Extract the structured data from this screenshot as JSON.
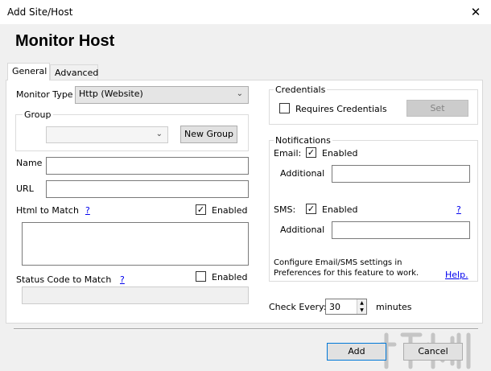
{
  "window": {
    "title": "Add Site/Host",
    "close_glyph": "✕"
  },
  "heading": "Monitor Host",
  "tabs": [
    {
      "label": "General"
    },
    {
      "label": "Advanced"
    }
  ],
  "general": {
    "monitor_type_label": "Monitor Type",
    "monitor_type_value": "Http (Website)",
    "group_title": "Group",
    "group_value": "",
    "new_group_label": "New Group",
    "name_label": "Name",
    "name_value": "",
    "url_label": "URL",
    "url_value": "",
    "html_match_label": "Html to Match",
    "help_link": "?",
    "html_match_enabled_label": "Enabled",
    "html_match_enabled_mark": "✓",
    "status_code_label": "Status Code to Match",
    "status_code_enabled_label": "Enabled",
    "status_code_value": ""
  },
  "credentials": {
    "title": "Credentials",
    "requires_label": "Requires Credentials",
    "set_label": "Set"
  },
  "notifications": {
    "title": "Notifications",
    "email_label": "Email:",
    "email_enabled_label": "Enabled",
    "email_mark": "✓",
    "additional_label": "Additional",
    "email_additional_value": "",
    "sms_label": "SMS:",
    "sms_enabled_label": "Enabled",
    "sms_mark": "✓",
    "sms_help": "?",
    "sms_additional_value": "",
    "info_line1": "Configure Email/SMS settings in",
    "info_line2": "Preferences for this feature to work.",
    "help_link": "Help."
  },
  "check_every": {
    "label": "Check Every:",
    "value": "30",
    "unit": "minutes"
  },
  "footer": {
    "add_label": "Add",
    "cancel_label": "Cancel"
  },
  "icons": {
    "chevron": "chevron-down-icon",
    "spin_up": "spin-up-icon",
    "spin_down": "spin-down-icon"
  }
}
